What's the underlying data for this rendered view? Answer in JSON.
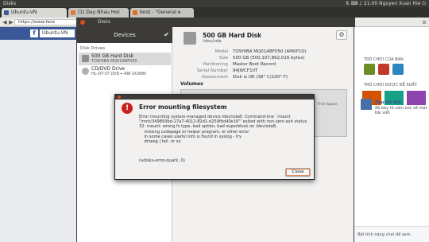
{
  "topbar": {
    "app_title": "Disks",
    "tray_time": "21:00",
    "tray_user": "Nguyen Xuan Hie"
  },
  "browser": {
    "tabs": [
      {
        "label": "Ubuntu-VN"
      },
      {
        "label": "(1) Day Nhau Hoc"
      },
      {
        "label": "boot - \"General e"
      },
      {
        "label": "Disks"
      }
    ],
    "url": "https://www.face",
    "fb_search": "Ubuntu-VN"
  },
  "disks": {
    "window_title": "Disks",
    "devices_header": "Devices",
    "disk_drives_label": "Disk Drives",
    "devices": [
      {
        "name": "500 GB Hard Disk",
        "sub": "TOSHIBA MQ01ABF050"
      },
      {
        "name": "CD/DVD Drive",
        "sub": "HL-DT-ST DVD+-RW GU90N"
      }
    ],
    "disk": {
      "title": "500 GB Hard Disk",
      "path": "/dev/sda",
      "props": [
        {
          "k": "Model",
          "v": "TOSHIBA MQ01ABF050 (AM0P1D)"
        },
        {
          "k": "Size",
          "v": "500 GB (500,107,862,016 bytes)"
        },
        {
          "k": "Partitioning",
          "v": "Master Boot Record"
        },
        {
          "k": "Serial Number",
          "v": "84JWCF10T"
        },
        {
          "k": "Assessment",
          "v": "Disk is OK (38° C/100° F)"
        }
      ],
      "volumes_label": "Volumes",
      "free_space_label": "Free Space"
    }
  },
  "dialog": {
    "title": "Error mounting filesystem",
    "body": "Error mounting system-managed device /dev/sda8: Command-line `mount \"/mnt/349893bd-27a7-4012-82d1-d259fbd40e16\"' exited with non-zero exit status 32: mount: wrong fs type, bad option, bad superblock on /dev/sda8,\n    missing codepage or helper program, or other error\n    In some cases useful info is found in syslog - try\n    dmesg | tail  or so",
    "quark": "(udisks-error-quark, 0)",
    "close_label": "Close"
  },
  "facebook_right": {
    "section1": "TRÒ CHƠI CỦA BẠN",
    "section2": "TRÒ CHƠI ĐƯỢC ĐỀ XUẤT",
    "story_name": "Nguyễn Đức",
    "story_text": "đã bày tỏ cảm xúc về một bài viết",
    "footer": "Bật tính năng chat để xem"
  },
  "colors": {
    "ubuntu_dark": "#3c3b37",
    "facebook_blue": "#3b5998",
    "error_red": "#c7211d",
    "ubuntu_orange": "#df4a16"
  }
}
